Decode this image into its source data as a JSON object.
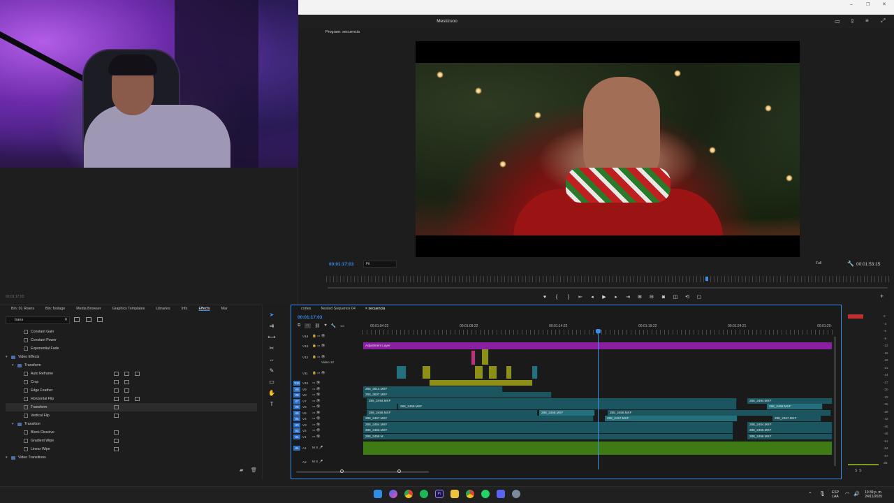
{
  "app": {
    "title": "Mestizooo",
    "program_tab": "Program: secuencia"
  },
  "left_panel": {
    "timecode": "00;01;17;03"
  },
  "program_monitor": {
    "current_time": "00:01:17:03",
    "fit_label": "Fit",
    "quality_label": "Full",
    "duration": "00:01:53:15"
  },
  "effects_panel": {
    "tabs": [
      "Bin: 01 Risers",
      "Bin: footage",
      "Media Browser",
      "Graphics Templates",
      "Libraries",
      "Info",
      "Effects",
      "Mar"
    ],
    "active_tab": "Effects",
    "search_value": "trans",
    "items": [
      {
        "label": "Constant Gain",
        "indent": 2,
        "kind": "fx"
      },
      {
        "label": "Constant Power",
        "indent": 2,
        "kind": "fx"
      },
      {
        "label": "Exponential Fade",
        "indent": 2,
        "kind": "fx"
      },
      {
        "label": "Video Effects",
        "indent": 0,
        "kind": "folder"
      },
      {
        "label": "Transform",
        "indent": 1,
        "kind": "folder"
      },
      {
        "label": "Auto Reframe",
        "indent": 2,
        "kind": "fx",
        "badges": 3
      },
      {
        "label": "Crop",
        "indent": 2,
        "kind": "fx",
        "badges": 2
      },
      {
        "label": "Edge Feather",
        "indent": 2,
        "kind": "fx",
        "badges": 2
      },
      {
        "label": "Horizontal Flip",
        "indent": 2,
        "kind": "fx",
        "badges": 3
      },
      {
        "label": "Transform",
        "indent": 2,
        "kind": "fx",
        "badges": 1,
        "selected": true
      },
      {
        "label": "Vertical Flip",
        "indent": 2,
        "kind": "fx",
        "badges": 1
      },
      {
        "label": "Transition",
        "indent": 1,
        "kind": "folder"
      },
      {
        "label": "Block Dissolve",
        "indent": 2,
        "kind": "fx",
        "badges": 1
      },
      {
        "label": "Gradient Wipe",
        "indent": 2,
        "kind": "fx",
        "badges": 1
      },
      {
        "label": "Linear Wipe",
        "indent": 2,
        "kind": "fx",
        "badges": 1
      },
      {
        "label": "Video Transitions",
        "indent": 0,
        "kind": "folder"
      }
    ]
  },
  "timeline": {
    "tabs": [
      "cortes",
      "Nested Sequence 04",
      "secuencia"
    ],
    "active_tab": "secuencia",
    "current_time": "00:01:17:03",
    "ruler": [
      "00:01:04:22",
      "00:01:09:22",
      "00:01:14:22",
      "00:01:19:22",
      "00:01:24:21",
      "00:01:29:"
    ],
    "tracks": [
      "V14",
      "V13",
      "V12",
      "Video 12",
      "V11",
      "V10",
      "V9",
      "V8",
      "V7",
      "V6",
      "V5",
      "V4",
      "V3",
      "V2",
      "V1",
      "A1",
      "A2"
    ],
    "clips": {
      "adjustment": "Adjustment Layer",
      "c1": "288_2514.MXF",
      "c2": "288_2507.MXF",
      "c3": "288_2494.MXF",
      "c4": "288_2459.MXF",
      "c5": "288_2458.MXF",
      "c6": "288_2457.MXF",
      "c7": "288_2454.MXF",
      "c8": "288_2453.MXF",
      "c9": "288_2456.MXF",
      "c10": "288_2455.MXF",
      "c11": "288_2456.M"
    }
  },
  "audio_meter": {
    "scale": [
      "0",
      "-3",
      "-6",
      "-9",
      "-12",
      "-15",
      "-18",
      "-21",
      "-24",
      "-27",
      "-30",
      "-33",
      "-36",
      "-39",
      "-42",
      "-45",
      "-48",
      "-51",
      "-54",
      "-57",
      "dB"
    ],
    "footer": "S  S"
  },
  "taskbar": {
    "lang": "ESP\nLAA",
    "time": "10:39 p. m.",
    "date": "24/11/2025"
  }
}
